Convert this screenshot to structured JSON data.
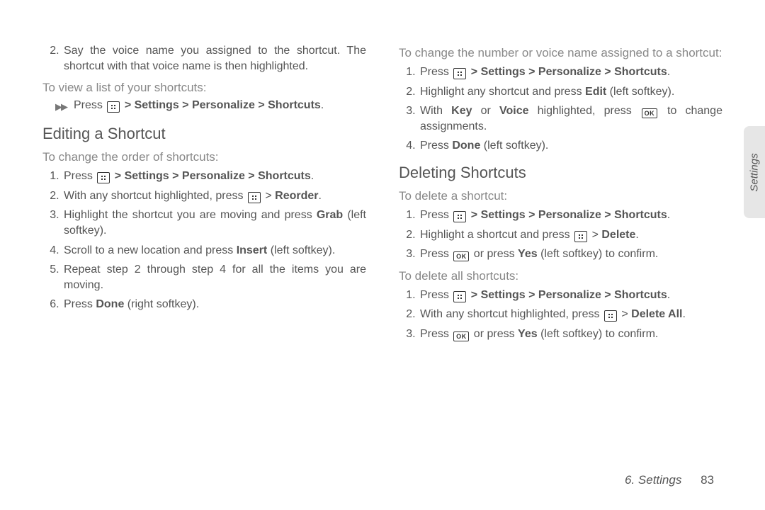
{
  "left": {
    "step2": {
      "num": "2.",
      "text_a": "Say the voice name you assigned to the shortcut. The shortcut with that voice name is then highlighted."
    },
    "view_intro": "To view a list of your shortcuts:",
    "view_bullet_press": "Press",
    "view_bullet_path": "> Settings > Personalize > Shortcuts",
    "h_edit": "Editing a Shortcut",
    "edit_intro": "To change the order of shortcuts:",
    "edit_steps": {
      "s1_a": "Press ",
      "s1_path": " > Settings > Personalize > Shortcuts",
      "s2_a": "With any shortcut highlighted, press ",
      "s2_b": " > ",
      "s2_bold": "Reorder",
      "s3_a": "Highlight the shortcut you are moving and press ",
      "s3_bold": "Grab",
      "s3_b": " (left softkey).",
      "s4_a": "Scroll to a new location and press ",
      "s4_bold": "Insert",
      "s4_b": " (left softkey).",
      "s5": "Repeat step 2 through step 4 for all the items you are moving.",
      "s6_a": "Press ",
      "s6_bold": "Done",
      "s6_b": " (right softkey)."
    }
  },
  "right": {
    "change_intro": "To change the number or voice name assigned to a shortcut:",
    "change": {
      "s1_a": "Press ",
      "s1_path": " > Settings > Personalize > Shortcuts",
      "s2_a": "Highlight any shortcut and press ",
      "s2_bold": "Edit",
      "s2_b": " (left softkey).",
      "s3_a": "With ",
      "s3_bold1": "Key",
      "s3_mid": " or ",
      "s3_bold2": "Voice",
      "s3_b": " highlighted, press ",
      "s3_c": " to change assignments.",
      "s4_a": "Press ",
      "s4_bold": "Done",
      "s4_b": " (left softkey)."
    },
    "h_delete": "Deleting Shortcuts",
    "del_one_intro": "To delete a shortcut:",
    "del_one": {
      "s1_a": "Press ",
      "s1_path": " > Settings > Personalize > Shortcuts",
      "s2_a": "Highlight a shortcut and press ",
      "s2_b": " > ",
      "s2_bold": "Delete",
      "s3_a": "Press ",
      "s3_b": " or press ",
      "s3_bold": "Yes",
      "s3_c": " (left softkey) to confirm."
    },
    "del_all_intro": "To delete all shortcuts:",
    "del_all": {
      "s1_a": "Press ",
      "s1_path": " > Settings > Personalize > Shortcuts",
      "s2_a": "With any shortcut highlighted, press ",
      "s2_b": " > ",
      "s2_bold": "Delete All",
      "s3_a": "Press ",
      "s3_b": " or press ",
      "s3_bold": "Yes",
      "s3_c": " (left softkey) to confirm."
    }
  },
  "tab_label": "Settings",
  "footer_chapter": "6. Settings",
  "footer_page": "83",
  "period": "."
}
